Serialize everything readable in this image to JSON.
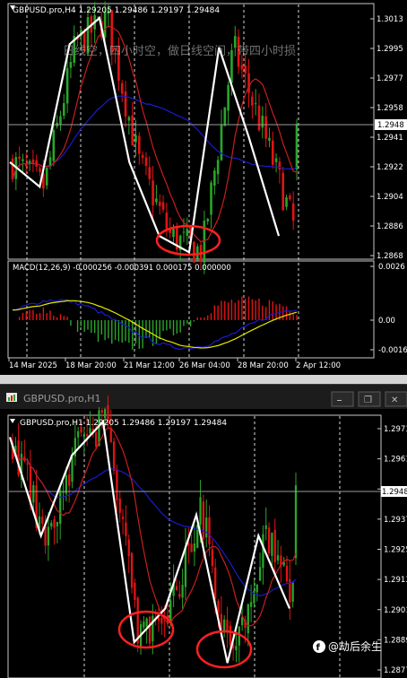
{
  "top_window": {
    "header": "GBPUSD.pro,H4  1.29205 1.29486 1.29197 1.29484",
    "annotation": "日线空，四小时空，做日线空间，带四小时损",
    "price_axis": [
      "1.3013",
      "1.2995",
      "1.2977",
      "1.2958",
      "1.2941",
      "1.2922",
      "1.2904",
      "1.2886",
      "1.2868"
    ],
    "current_price": "1.2948",
    "macd_header": "MACD(12,26,9) -0.000256 -0.000391 0.000175 0.000000",
    "macd_axis": [
      "0.0026",
      "0.00",
      "-0.0016"
    ],
    "time_axis": [
      "14 Mar 2025",
      "18 Mar 20:00",
      "21 Mar 12:00",
      "26 Mar 04:00",
      "28 Mar 20:00",
      "2 Apr 12:00"
    ]
  },
  "bottom_window": {
    "title": "GBPUSD.pro,H1",
    "header": "GBPUSD.pro,H1  1.29205 1.29486 1.29197 1.29484",
    "price_axis": [
      "1.2973",
      "1.2961",
      "1.2949",
      "1.2937",
      "1.2925",
      "1.2913",
      "1.2901",
      "1.2889",
      "1.2877"
    ],
    "current_price": "1.2948",
    "controls": {
      "minimize": "⎯",
      "restore": "❐",
      "close": "✕"
    }
  },
  "watermark": "@劫后余生",
  "colors": {
    "bull": "#2aa52a",
    "bear": "#e01414",
    "ma_red": "#c81e1e",
    "ma_blue": "#1a1acc",
    "wave": "#ffffff",
    "circle": "#ff2020",
    "macd_signal": "#e6e600"
  },
  "chart_data": [
    {
      "type": "candlestick",
      "title": "GBPUSD.pro,H4",
      "ylim": [
        1.2868,
        1.3013
      ],
      "x_labels": [
        "14 Mar 2025",
        "18 Mar 20:00",
        "21 Mar 12:00",
        "26 Mar 04:00",
        "28 Mar 20:00",
        "2 Apr 12:00"
      ],
      "last": {
        "open": 1.29205,
        "high": 1.29486,
        "low": 1.29197,
        "close": 1.29484
      },
      "wave_path": [
        1.2925,
        1.291,
        1.2997,
        1.3013,
        1.2925,
        1.288,
        1.287,
        1.2995,
        1.294,
        1.288
      ],
      "highlight": "low near 1.2870"
    },
    {
      "type": "bar",
      "title": "MACD(12,26,9)",
      "values": {
        "macd": -0.000256,
        "signal": -0.000391,
        "histogram": 0.000175
      },
      "ylim": [
        -0.0016,
        0.0026
      ]
    },
    {
      "type": "candlestick",
      "title": "GBPUSD.pro,H1",
      "ylim": [
        1.2877,
        1.2973
      ],
      "last": {
        "open": 1.29205,
        "high": 1.29486,
        "low": 1.29197,
        "close": 1.29484
      },
      "wave_path": [
        1.2967,
        1.2929,
        1.296,
        1.2973,
        1.2888,
        1.2901,
        1.2937,
        1.288,
        1.2929,
        1.2901
      ],
      "highlight": [
        "low near 1.2888",
        "low near 1.2880"
      ]
    }
  ]
}
